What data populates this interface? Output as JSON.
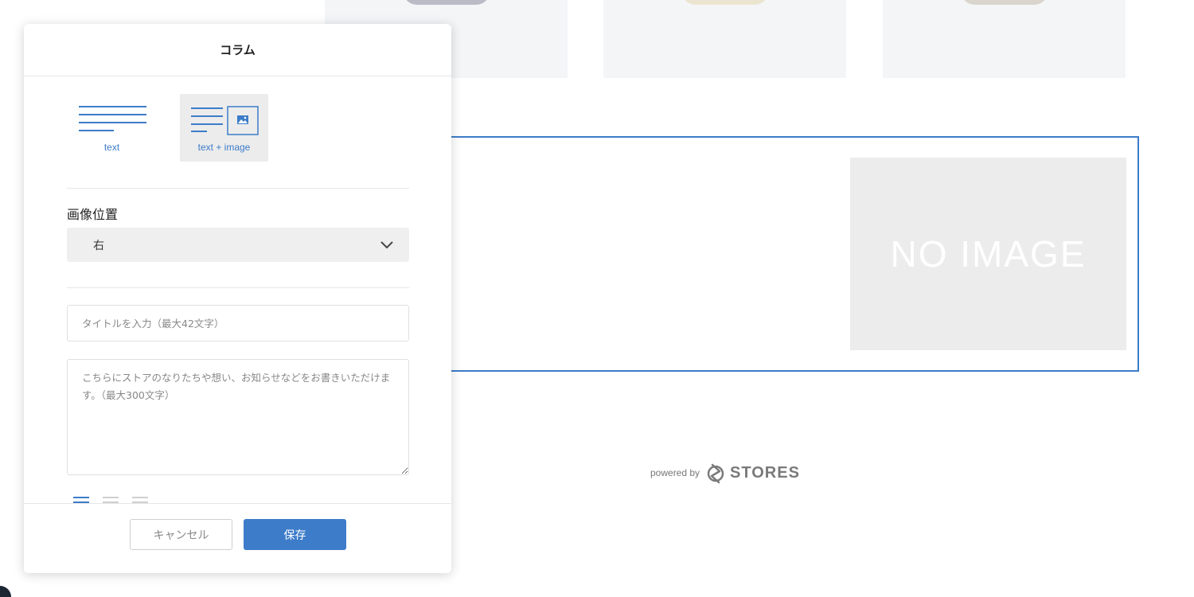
{
  "background_page": {
    "products": [
      {
        "name": "product-card-1"
      },
      {
        "name": "product-card-2"
      },
      {
        "name": "product-card-3"
      }
    ],
    "column_block": {
      "no_image_text": "NO IMAGE"
    },
    "footer": {
      "powered_by": "powered by",
      "brand": "STORES"
    }
  },
  "modal": {
    "title": "コラム",
    "layout_options": [
      {
        "label": "text",
        "selected": false
      },
      {
        "label": "text + image",
        "selected": true
      }
    ],
    "image_position": {
      "label": "画像位置",
      "selected_value": "右"
    },
    "title_input": {
      "placeholder": "タイトルを入力（最大42文字）",
      "value": ""
    },
    "body_textarea": {
      "placeholder": "こちらにストアのなりたちや想い、お知らせなどをお書きいただけます。（最大300文字）",
      "value": ""
    },
    "text_alignment": {
      "options": [
        "left",
        "center",
        "right"
      ],
      "selected": "left"
    },
    "cancel_label": "キャンセル",
    "save_label": "保存"
  },
  "colors": {
    "accent": "#3d7cc9",
    "selected_option_bg": "#ececec",
    "no_image_bg": "#ececec"
  }
}
